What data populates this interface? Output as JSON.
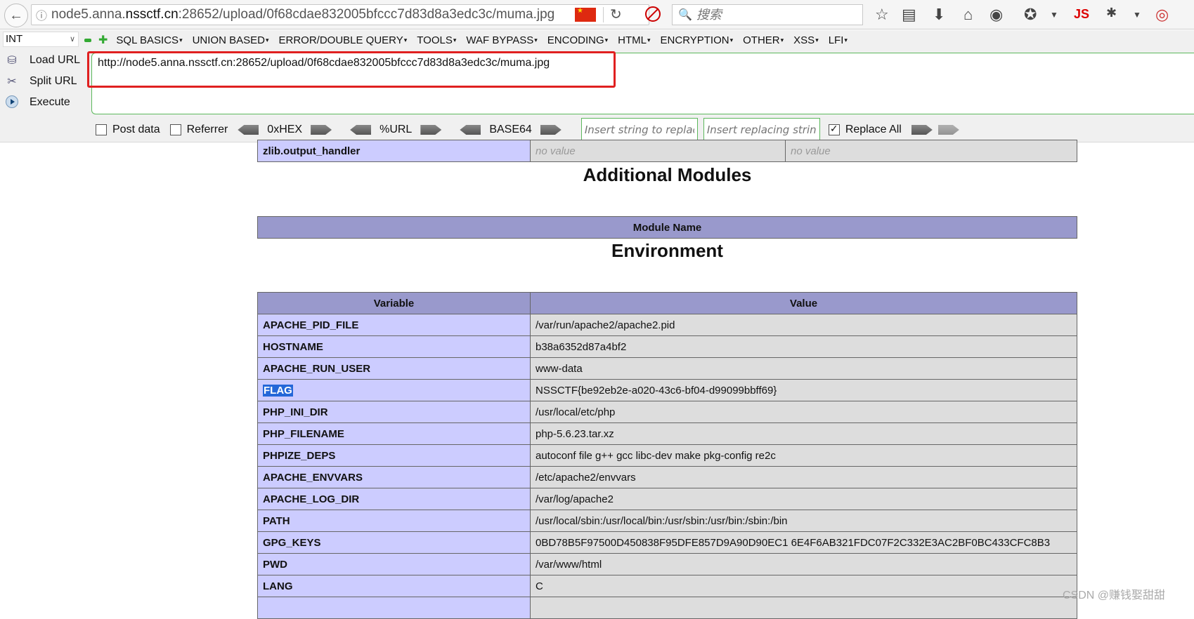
{
  "browser": {
    "url_prefix": "node5.anna.",
    "url_domain": "nssctf.cn",
    "url_suffix": ":28652/upload/0f68cdae832005bfccc7d83d8a3edc3c/muma.jpg",
    "search_placeholder": "搜索",
    "js_label": "JS"
  },
  "hackbar": {
    "select_value": "INT",
    "menus": [
      "SQL BASICS",
      "UNION BASED",
      "ERROR/DOUBLE QUERY",
      "TOOLS",
      "WAF BYPASS",
      "ENCODING",
      "HTML",
      "ENCRYPTION",
      "OTHER",
      "XSS",
      "LFI"
    ],
    "load_url": "Load URL",
    "split_url": "Split URL",
    "execute": "Execute",
    "url_value": "http://node5.anna.nssctf.cn:28652/upload/0f68cdae832005bfccc7d83d8a3edc3c/muma.jpg",
    "post_data": "Post data",
    "referrer": "Referrer",
    "hex": "0xHEX",
    "urlenc": "%URL",
    "base64": "BASE64",
    "replace_from_ph": "Insert string to replace",
    "replace_to_ph": "Insert replacing string",
    "replace_all": "Replace All"
  },
  "phpinfo": {
    "zlib_row": {
      "name": "zlib.output_handler",
      "local": "no value",
      "master": "no value"
    },
    "additional_modules_title": "Additional Modules",
    "module_name_header": "Module Name",
    "environment_title": "Environment",
    "env_headers": {
      "variable": "Variable",
      "value": "Value"
    },
    "env_rows": [
      {
        "name": "APACHE_PID_FILE",
        "value": "/var/run/apache2/apache2.pid"
      },
      {
        "name": "HOSTNAME",
        "value": "b38a6352d87a4bf2"
      },
      {
        "name": "APACHE_RUN_USER",
        "value": "www-data"
      },
      {
        "name": "FLAG",
        "value": "NSSCTF{be92eb2e-a020-43c6-bf04-d99099bbff69}"
      },
      {
        "name": "PHP_INI_DIR",
        "value": "/usr/local/etc/php"
      },
      {
        "name": "PHP_FILENAME",
        "value": "php-5.6.23.tar.xz"
      },
      {
        "name": "PHPIZE_DEPS",
        "value": "autoconf file g++ gcc libc-dev make pkg-config re2c"
      },
      {
        "name": "APACHE_ENVVARS",
        "value": "/etc/apache2/envvars"
      },
      {
        "name": "APACHE_LOG_DIR",
        "value": "/var/log/apache2"
      },
      {
        "name": "PATH",
        "value": "/usr/local/sbin:/usr/local/bin:/usr/sbin:/usr/bin:/sbin:/bin"
      },
      {
        "name": "GPG_KEYS",
        "value": "0BD78B5F97500D450838F95DFE857D9A90D90EC1 6E4F6AB321FDC07F2C332E3AC2BF0BC433CFC8B3"
      },
      {
        "name": "PWD",
        "value": "/var/www/html"
      },
      {
        "name": "LANG",
        "value": "C"
      }
    ]
  },
  "watermark": "CSDN @赚钱娶甜甜"
}
